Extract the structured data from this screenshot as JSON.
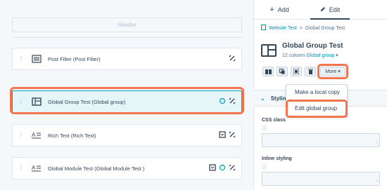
{
  "editor": {
    "header_label": "Header",
    "modules": [
      {
        "label": "Post Filter (Post Filter)",
        "icon": "post-filter-icon"
      },
      {
        "label": "Global Group Test (Global group)",
        "icon": "group-layout-icon"
      },
      {
        "label": "Rich Text (Rich Text)",
        "icon": "rich-text-icon"
      },
      {
        "label": "Global Module Test (Global Module Test )",
        "icon": "rich-text-icon"
      }
    ]
  },
  "sidebar": {
    "tabs": [
      {
        "label": "Add",
        "icon": "plus-icon"
      },
      {
        "label": "Edit",
        "icon": "pencil-icon"
      }
    ],
    "breadcrumb": {
      "link": "Website Test",
      "separator": ">",
      "current": "Global Group Test"
    },
    "title": "Global Group Test",
    "subtitle_prefix": "12 column",
    "subtitle_link": "Global group",
    "more_label": "More",
    "dropdown_items": [
      "Make a local copy",
      "Edit global group"
    ],
    "section_label": "Styling",
    "css_class_label": "CSS class",
    "inline_styling_label": "Inline styling"
  },
  "colors": {
    "accent_highlight": "#f2754f",
    "link": "#0091ae",
    "selected_bg": "#e5f5f8",
    "text": "#33475b"
  }
}
